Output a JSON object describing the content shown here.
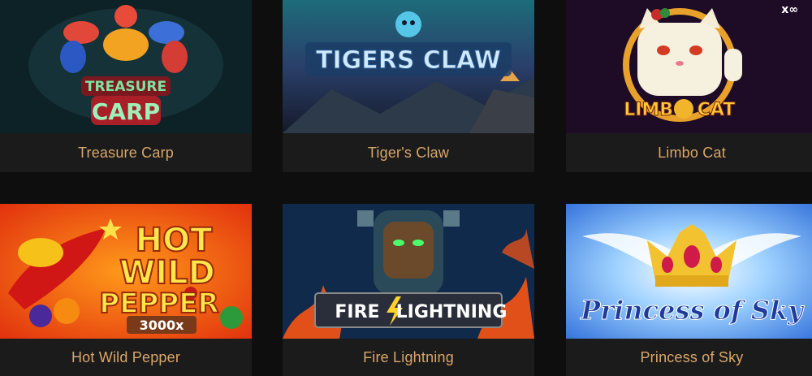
{
  "games": [
    {
      "title": "Treasure Carp",
      "logo_lines": [
        "TREASURE",
        "CARP"
      ]
    },
    {
      "title": "Tiger's Claw",
      "logo_lines": [
        "TIGERS CLAW"
      ]
    },
    {
      "title": "Limbo Cat",
      "logo_lines": [
        "LIMBO",
        "CAT"
      ],
      "badge": "x∞"
    },
    {
      "title": "Hot Wild Pepper",
      "logo_lines": [
        "HOT",
        "WILD",
        "PEPPER"
      ],
      "badge": "3000x"
    },
    {
      "title": "Fire Lightning",
      "logo_lines": [
        "FIRE",
        "LIGHTNING"
      ]
    },
    {
      "title": "Princess of Sky",
      "logo_lines": [
        "Princess of Sky"
      ]
    }
  ],
  "colors": {
    "background": "#0e0e0e",
    "card": "#1b1b1b",
    "label": "#d9a66a"
  }
}
